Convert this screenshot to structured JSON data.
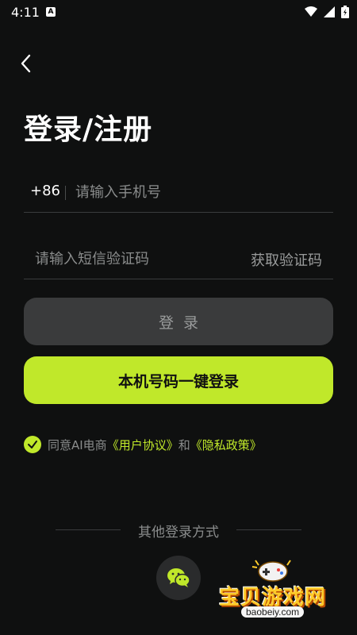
{
  "status_bar": {
    "time": "4:11",
    "notification_letter": "A"
  },
  "header": {
    "title": "登录/注册"
  },
  "phone": {
    "country_code": "+86",
    "placeholder": "请输入手机号"
  },
  "sms": {
    "placeholder": "请输入短信验证码",
    "get_code_label": "获取验证码"
  },
  "buttons": {
    "login_label": "登录",
    "one_key_label": "本机号码一键登录"
  },
  "agreement": {
    "checked": true,
    "prefix": "同意AI电商",
    "user_agreement": "《用户协议》",
    "and": "和",
    "privacy_policy": "《隐私政策》"
  },
  "other_login": {
    "label": "其他登录方式",
    "methods": [
      "wechat"
    ]
  },
  "watermark": {
    "brand": "宝贝游戏网",
    "url": "baobeiy.com"
  },
  "colors": {
    "accent": "#c0e82a",
    "background": "#0f1010",
    "secondary_button": "#3a3b3c"
  }
}
